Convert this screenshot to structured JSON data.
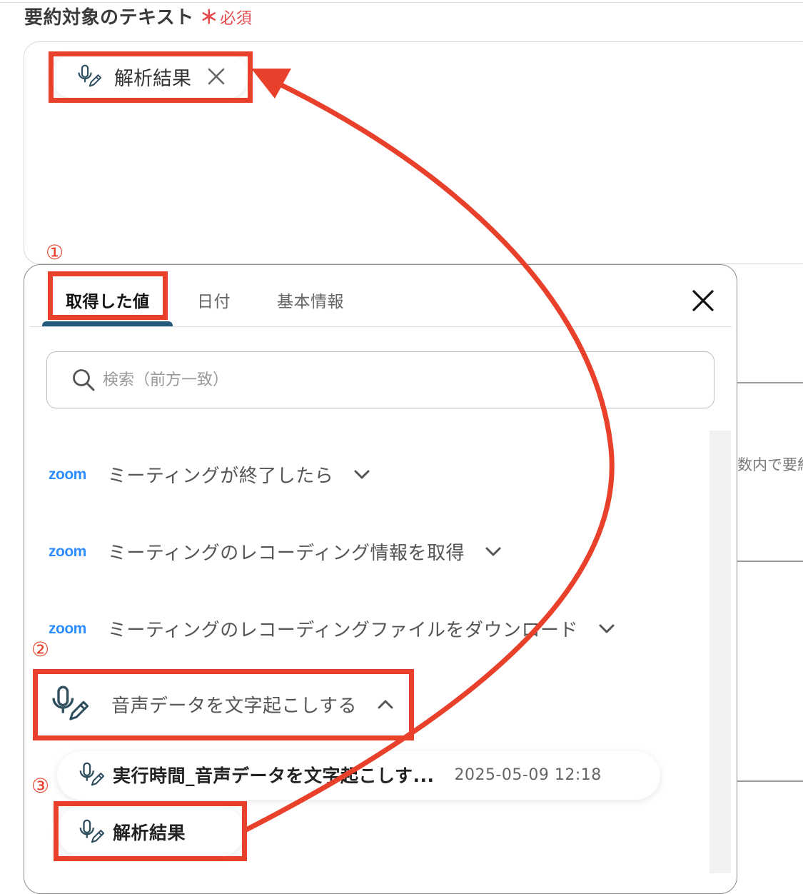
{
  "field": {
    "label": "要約対象のテキスト",
    "required_mark": "＊",
    "required_text": "必須"
  },
  "selected_chip": {
    "label": "解析結果",
    "icon": "mic-pen-icon"
  },
  "panel": {
    "tabs": [
      {
        "label": "取得した値",
        "active": true
      },
      {
        "label": "日付",
        "active": false
      },
      {
        "label": "基本情報",
        "active": false
      }
    ],
    "search_placeholder": "検索（前方一致）",
    "groups": [
      {
        "logo": "zoom",
        "label": "ミーティングが終了したら",
        "expanded": false
      },
      {
        "logo": "zoom",
        "label": "ミーティングのレコーディング情報を取得",
        "expanded": false
      },
      {
        "logo": "zoom",
        "label": "ミーティングのレコーディングファイルをダウンロード",
        "expanded": false
      },
      {
        "logo": "mic-pen-icon",
        "label": "音声データを文字起こしする",
        "expanded": true
      }
    ],
    "items": [
      {
        "label": "実行時間_音声データを文字起こしす...",
        "value": "2025-05-09 12:18"
      },
      {
        "label": "解析結果",
        "value": ""
      }
    ]
  },
  "background_text": "数内で要約",
  "annotations": {
    "step1": "①",
    "step2": "②",
    "step3": "③"
  },
  "colors": {
    "annotation_red": "#e8402a",
    "tab_active_underline": "#245b7d",
    "required_red": "#e5484d",
    "zoom_blue": "#2d8cff"
  }
}
